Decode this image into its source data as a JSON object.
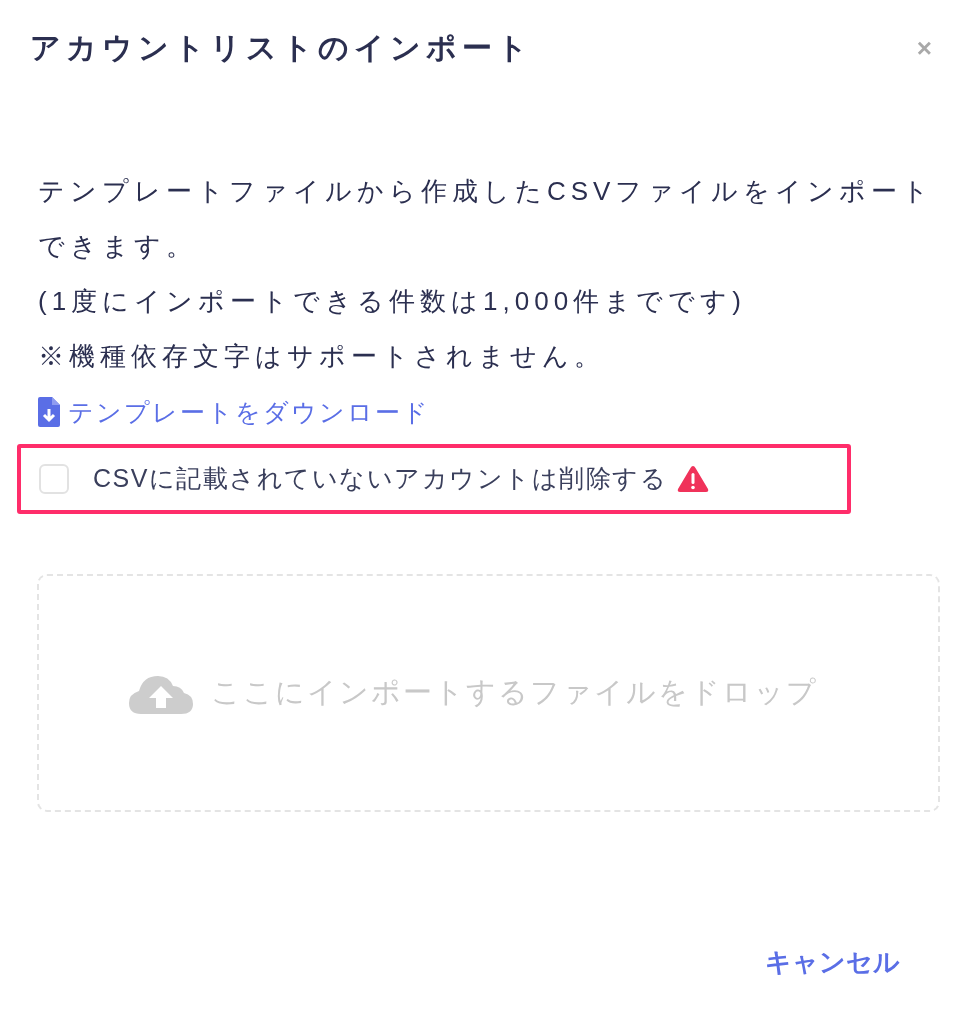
{
  "dialog": {
    "title": "アカウントリストのインポート",
    "close": "×"
  },
  "description": [
    "テンプレートファイルから作成したCSVファイルをインポートできます。",
    "(1度にインポートできる件数は1,000件までです)",
    "※機種依存文字はサポートされません。"
  ],
  "template_link": {
    "label": "テンプレートをダウンロード"
  },
  "delete_option": {
    "label": "CSVに記載されていないアカウントは削除する",
    "checked": false,
    "highlighted": true,
    "warning": true
  },
  "drop_zone": {
    "label": "ここにインポートするファイルをドロップ"
  },
  "buttons": [
    {
      "label": "キャンセル",
      "kind": "text"
    }
  ]
}
